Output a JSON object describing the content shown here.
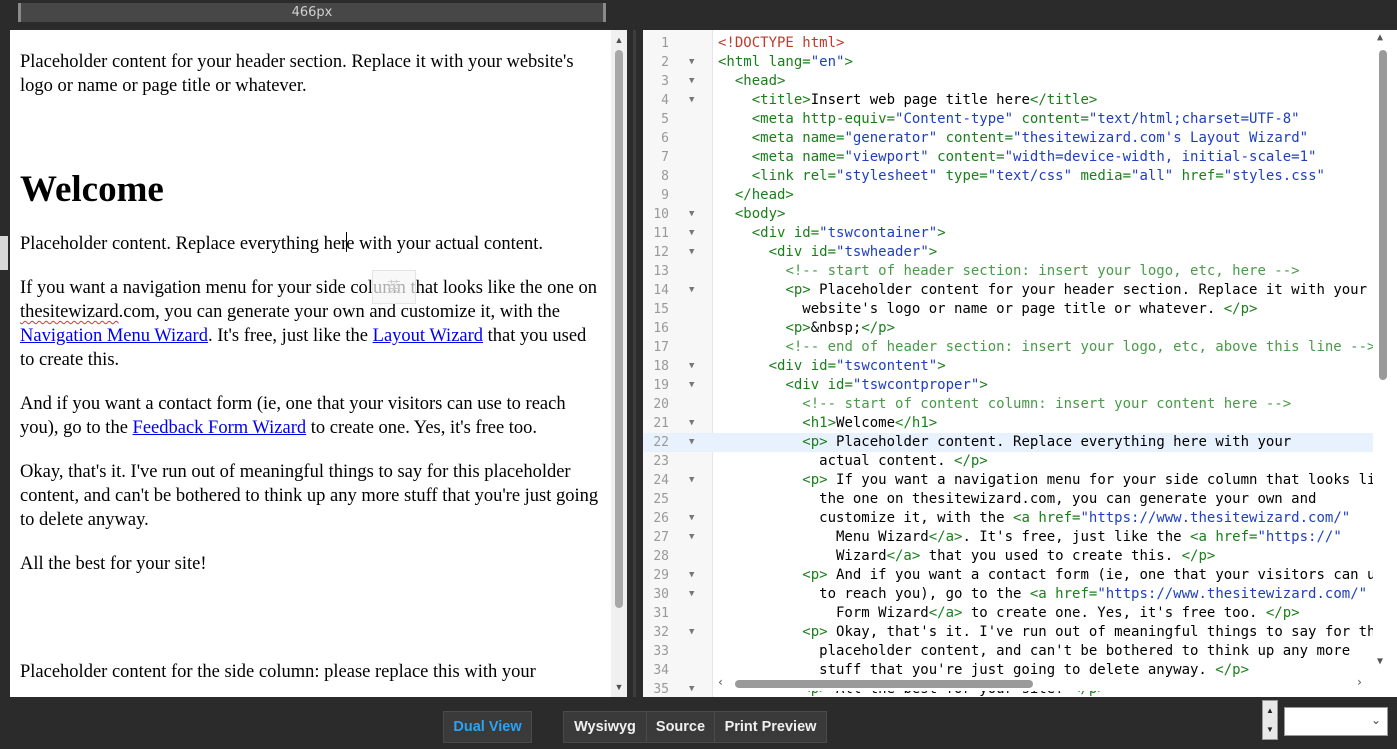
{
  "ruler": {
    "width_label": "466px"
  },
  "preview": {
    "header_text": "Placeholder content for your header section. Replace it with your website's logo or name or page title or whatever.",
    "heading": "Welcome",
    "p1_before_cursor": "Placeholder content. Replace everything her",
    "p1_after_cursor": "e with your actual content.",
    "ime_hint": "英",
    "p2_part1": "If you want a navigation menu for your side column that looks like the one on ",
    "p2_squiggle": "thesitewizard",
    "p2_part2": ".com, you can generate your own and customize it, with the ",
    "p2_link1": "Navigation Menu Wizard",
    "p2_part3": ". It's free, just like the ",
    "p2_link2": "Layout Wizard",
    "p2_part4": " that you used to create this.",
    "p3_part1": "And if you want a contact form (ie, one that your visitors can use to reach you), go to the ",
    "p3_link": "Feedback Form Wizard",
    "p3_part2": " to create one. Yes, it's free too.",
    "p4": "Okay, that's it. I've run out of meaningful things to say for this placeholder content, and can't be bothered to think up any more stuff that you're just going to delete anyway.",
    "p5": "All the best for your site!",
    "side_text": "Placeholder content for the side column: please replace this with your"
  },
  "code": {
    "lines": [
      {
        "n": "1",
        "fold": "",
        "tokens": [
          [
            "t-dt",
            "<!DOCTYPE html>"
          ]
        ]
      },
      {
        "n": "2",
        "fold": "▼",
        "tokens": [
          [
            "t-tag",
            "<html "
          ],
          [
            "t-attr",
            "lang="
          ],
          [
            "t-val",
            "\"en\""
          ],
          [
            "t-tag",
            ">"
          ]
        ]
      },
      {
        "n": "3",
        "fold": "▼",
        "tokens": [
          [
            "t-txt",
            "  "
          ],
          [
            "t-tag",
            "<head>"
          ]
        ]
      },
      {
        "n": "4",
        "fold": "▼",
        "tokens": [
          [
            "t-txt",
            "    "
          ],
          [
            "t-tag",
            "<title>"
          ],
          [
            "t-txt",
            "Insert web page title here"
          ],
          [
            "t-tag",
            "</title>"
          ]
        ]
      },
      {
        "n": "5",
        "fold": "",
        "tokens": [
          [
            "t-txt",
            "    "
          ],
          [
            "t-tag",
            "<meta "
          ],
          [
            "t-attr",
            "http-equiv="
          ],
          [
            "t-val",
            "\"Content-type\" "
          ],
          [
            "t-attr",
            "content="
          ],
          [
            "t-val",
            "\"text/html;charset=UTF-8\""
          ]
        ]
      },
      {
        "n": "6",
        "fold": "",
        "tokens": [
          [
            "t-txt",
            "    "
          ],
          [
            "t-tag",
            "<meta "
          ],
          [
            "t-attr",
            "name="
          ],
          [
            "t-val",
            "\"generator\" "
          ],
          [
            "t-attr",
            "content="
          ],
          [
            "t-val",
            "\"thesitewizard.com's Layout Wizard\""
          ]
        ]
      },
      {
        "n": "7",
        "fold": "",
        "tokens": [
          [
            "t-txt",
            "    "
          ],
          [
            "t-tag",
            "<meta "
          ],
          [
            "t-attr",
            "name="
          ],
          [
            "t-val",
            "\"viewport\" "
          ],
          [
            "t-attr",
            "content="
          ],
          [
            "t-val",
            "\"width=device-width, initial-scale=1\""
          ]
        ]
      },
      {
        "n": "8",
        "fold": "",
        "tokens": [
          [
            "t-txt",
            "    "
          ],
          [
            "t-tag",
            "<link "
          ],
          [
            "t-attr",
            "rel="
          ],
          [
            "t-val",
            "\"stylesheet\" "
          ],
          [
            "t-attr",
            "type="
          ],
          [
            "t-val",
            "\"text/css\" "
          ],
          [
            "t-attr",
            "media="
          ],
          [
            "t-val",
            "\"all\" "
          ],
          [
            "t-attr",
            "href="
          ],
          [
            "t-val",
            "\"styles.css\""
          ]
        ]
      },
      {
        "n": "9",
        "fold": "",
        "tokens": [
          [
            "t-txt",
            "  "
          ],
          [
            "t-tag",
            "</head>"
          ]
        ]
      },
      {
        "n": "10",
        "fold": "▼",
        "tokens": [
          [
            "t-txt",
            "  "
          ],
          [
            "t-tag",
            "<body>"
          ]
        ]
      },
      {
        "n": "11",
        "fold": "▼",
        "tokens": [
          [
            "t-txt",
            "    "
          ],
          [
            "t-tag",
            "<div "
          ],
          [
            "t-attr",
            "id="
          ],
          [
            "t-val",
            "\"tswcontainer\""
          ],
          [
            "t-tag",
            ">"
          ]
        ]
      },
      {
        "n": "12",
        "fold": "▼",
        "tokens": [
          [
            "t-txt",
            "      "
          ],
          [
            "t-tag",
            "<div "
          ],
          [
            "t-attr",
            "id="
          ],
          [
            "t-val",
            "\"tswheader\""
          ],
          [
            "t-tag",
            ">"
          ]
        ]
      },
      {
        "n": "13",
        "fold": "",
        "tokens": [
          [
            "t-txt",
            "        "
          ],
          [
            "t-cmt",
            "<!-- start of header section: insert your logo, etc, here -->"
          ]
        ]
      },
      {
        "n": "14",
        "fold": "▼",
        "tokens": [
          [
            "t-txt",
            "        "
          ],
          [
            "t-tag",
            "<p>"
          ],
          [
            "t-txt",
            " Placeholder content for your header section. Replace it with your"
          ]
        ]
      },
      {
        "n": "15",
        "fold": "",
        "tokens": [
          [
            "t-txt",
            "          website's logo or name or page title or whatever. "
          ],
          [
            "t-tag",
            "</p>"
          ]
        ]
      },
      {
        "n": "16",
        "fold": "",
        "tokens": [
          [
            "t-txt",
            "        "
          ],
          [
            "t-tag",
            "<p>"
          ],
          [
            "t-txt",
            "&nbsp;"
          ],
          [
            "t-tag",
            "</p>"
          ]
        ]
      },
      {
        "n": "17",
        "fold": "",
        "tokens": [
          [
            "t-txt",
            "        "
          ],
          [
            "t-cmt",
            "<!-- end of header section: insert your logo, etc, above this line -->"
          ]
        ]
      },
      {
        "n": "18",
        "fold": "▼",
        "tokens": [
          [
            "t-txt",
            "      "
          ],
          [
            "t-tag",
            "<div "
          ],
          [
            "t-attr",
            "id="
          ],
          [
            "t-val",
            "\"tswcontent\""
          ],
          [
            "t-tag",
            ">"
          ]
        ]
      },
      {
        "n": "19",
        "fold": "▼",
        "tokens": [
          [
            "t-txt",
            "        "
          ],
          [
            "t-tag",
            "<div "
          ],
          [
            "t-attr",
            "id="
          ],
          [
            "t-val",
            "\"tswcontproper\""
          ],
          [
            "t-tag",
            ">"
          ]
        ]
      },
      {
        "n": "20",
        "fold": "",
        "tokens": [
          [
            "t-txt",
            "          "
          ],
          [
            "t-cmt",
            "<!-- start of content column: insert your content here -->"
          ]
        ]
      },
      {
        "n": "21",
        "fold": "▼",
        "tokens": [
          [
            "t-txt",
            "          "
          ],
          [
            "t-tag",
            "<h1>"
          ],
          [
            "t-txt",
            "Welcome"
          ],
          [
            "t-tag",
            "</h1>"
          ]
        ]
      },
      {
        "n": "22",
        "fold": "▼",
        "hl": true,
        "tokens": [
          [
            "t-txt",
            "          "
          ],
          [
            "t-tag",
            "<p>"
          ],
          [
            "t-txt",
            " Placeholder content. Replace everything here with your"
          ]
        ]
      },
      {
        "n": "23",
        "fold": "",
        "tokens": [
          [
            "t-txt",
            "            actual content. "
          ],
          [
            "t-tag",
            "</p>"
          ]
        ]
      },
      {
        "n": "24",
        "fold": "▼",
        "tokens": [
          [
            "t-txt",
            "          "
          ],
          [
            "t-tag",
            "<p>"
          ],
          [
            "t-txt",
            " If you want a navigation menu for your side column that looks like"
          ]
        ]
      },
      {
        "n": "25",
        "fold": "",
        "tokens": [
          [
            "t-txt",
            "            the one on thesitewizard.com, you can generate your own and"
          ]
        ]
      },
      {
        "n": "26",
        "fold": "▼",
        "tokens": [
          [
            "t-txt",
            "            customize it, with the "
          ],
          [
            "t-tag",
            "<a "
          ],
          [
            "t-attr",
            "href="
          ],
          [
            "t-val",
            "\"https://www.thesitewizard.com/\""
          ]
        ]
      },
      {
        "n": "27",
        "fold": "▼",
        "tokens": [
          [
            "t-txt",
            "              Menu Wizard"
          ],
          [
            "t-tag",
            "</a>"
          ],
          [
            "t-txt",
            ". It's free, just like the "
          ],
          [
            "t-tag",
            "<a "
          ],
          [
            "t-attr",
            "href="
          ],
          [
            "t-val",
            "\"https://\""
          ]
        ]
      },
      {
        "n": "28",
        "fold": "",
        "tokens": [
          [
            "t-txt",
            "              Wizard"
          ],
          [
            "t-tag",
            "</a>"
          ],
          [
            "t-txt",
            " that you used to create this. "
          ],
          [
            "t-tag",
            "</p>"
          ]
        ]
      },
      {
        "n": "29",
        "fold": "▼",
        "tokens": [
          [
            "t-txt",
            "          "
          ],
          [
            "t-tag",
            "<p>"
          ],
          [
            "t-txt",
            " And if you want a contact form (ie, one that your visitors can use"
          ]
        ]
      },
      {
        "n": "30",
        "fold": "▼",
        "tokens": [
          [
            "t-txt",
            "            to reach you), go to the "
          ],
          [
            "t-tag",
            "<a "
          ],
          [
            "t-attr",
            "href="
          ],
          [
            "t-val",
            "\"https://www.thesitewizard.com/\""
          ]
        ]
      },
      {
        "n": "31",
        "fold": "",
        "tokens": [
          [
            "t-txt",
            "              Form Wizard"
          ],
          [
            "t-tag",
            "</a>"
          ],
          [
            "t-txt",
            " to create one. Yes, it's free too. "
          ],
          [
            "t-tag",
            "</p>"
          ]
        ]
      },
      {
        "n": "32",
        "fold": "▼",
        "tokens": [
          [
            "t-txt",
            "          "
          ],
          [
            "t-tag",
            "<p>"
          ],
          [
            "t-txt",
            " Okay, that's it. I've run out of meaningful things to say for this"
          ]
        ]
      },
      {
        "n": "33",
        "fold": "",
        "tokens": [
          [
            "t-txt",
            "            placeholder content, and can't be bothered to think up any more"
          ]
        ]
      },
      {
        "n": "34",
        "fold": "",
        "tokens": [
          [
            "t-txt",
            "            stuff that you're just going to delete anyway. "
          ],
          [
            "t-tag",
            "</p>"
          ]
        ]
      },
      {
        "n": "35",
        "fold": "▼",
        "tokens": [
          [
            "t-txt",
            "          "
          ],
          [
            "t-tag",
            "<p>"
          ],
          [
            "t-txt",
            " All the best for your site! "
          ],
          [
            "t-tag",
            "</p>"
          ]
        ]
      }
    ]
  },
  "toolbar": {
    "dual_view": "Dual View",
    "wysiwyg": "Wysiwyg",
    "source": "Source",
    "print_preview": "Print Preview"
  },
  "colors": {
    "active_view": "#2aa3f5",
    "link": "#0000ee",
    "tag": "#1a7f1a",
    "value": "#1f3fbf",
    "comment": "#4a9a4a",
    "doctype": "#c0392b"
  }
}
